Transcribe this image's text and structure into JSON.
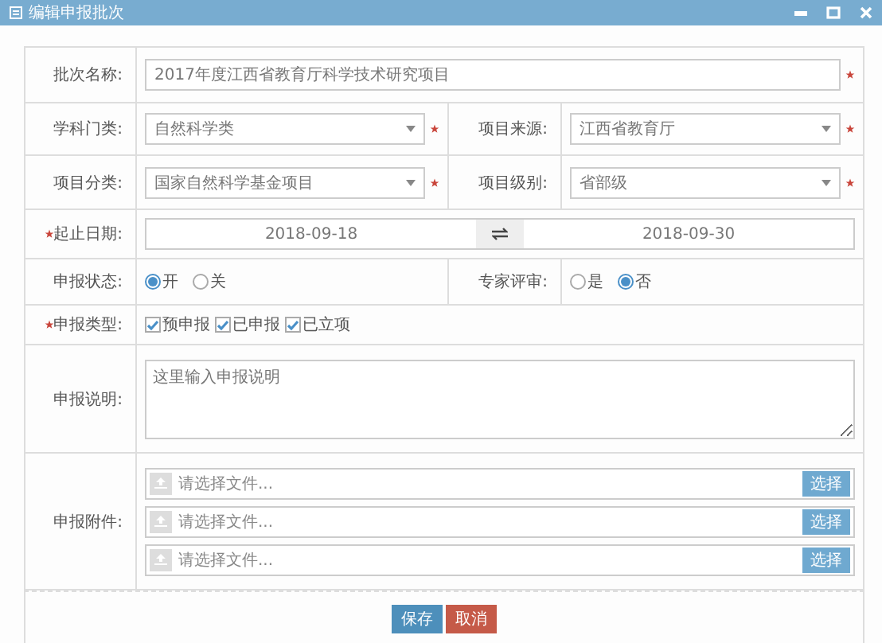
{
  "window": {
    "title": "编辑申报批次"
  },
  "form": {
    "batch_name": {
      "label": "批次名称:",
      "value": "2017年度江西省教育厅科学技术研究项目",
      "required": true
    },
    "discipline": {
      "label": "学科门类:",
      "value": "自然科学类",
      "required": true
    },
    "source": {
      "label": "项目来源:",
      "value": "江西省教育厅",
      "required": true
    },
    "category": {
      "label": "项目分类:",
      "value": "国家自然科学基金项目",
      "required": true
    },
    "grade": {
      "label": "项目级别:",
      "value": "省部级",
      "required": true
    },
    "dates": {
      "label": "起止日期:",
      "required": true,
      "start": "2018-09-18",
      "end": "2018-09-30"
    },
    "status": {
      "label": "申报状态:",
      "options": [
        {
          "label": "开",
          "selected": true
        },
        {
          "label": "关",
          "selected": false
        }
      ]
    },
    "review": {
      "label": "专家评审:",
      "options": [
        {
          "label": "是",
          "selected": false
        },
        {
          "label": "否",
          "selected": true
        }
      ]
    },
    "types": {
      "label": "申报类型:",
      "required": true,
      "options": [
        {
          "label": "预申报",
          "checked": true
        },
        {
          "label": "已申报",
          "checked": true
        },
        {
          "label": "已立项",
          "checked": true
        }
      ]
    },
    "description": {
      "label": "申报说明:",
      "placeholder": "这里输入申报说明"
    },
    "attachments": {
      "label": "申报附件:",
      "files": [
        {
          "placeholder": "请选择文件...",
          "button": "选择"
        },
        {
          "placeholder": "请选择文件...",
          "button": "选择"
        },
        {
          "placeholder": "请选择文件...",
          "button": "选择"
        }
      ]
    }
  },
  "buttons": [
    {
      "label": "保存",
      "kind": "primary"
    },
    {
      "label": "取消",
      "kind": "danger"
    }
  ]
}
